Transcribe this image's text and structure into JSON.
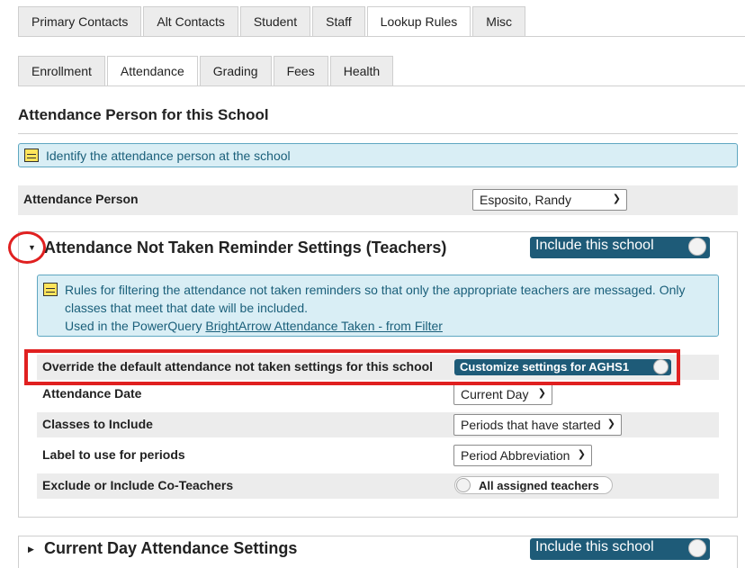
{
  "tabs_primary": [
    {
      "label": "Primary Contacts"
    },
    {
      "label": "Alt Contacts"
    },
    {
      "label": "Student"
    },
    {
      "label": "Staff"
    },
    {
      "label": "Lookup Rules"
    },
    {
      "label": "Misc"
    }
  ],
  "tabs_primary_active": "Lookup Rules",
  "tabs_secondary": [
    {
      "label": "Enrollment"
    },
    {
      "label": "Attendance"
    },
    {
      "label": "Grading"
    },
    {
      "label": "Fees"
    },
    {
      "label": "Health"
    }
  ],
  "tabs_secondary_active": "Attendance",
  "section": {
    "title": "Attendance Person for this School",
    "info": "Identify the attendance person at the school",
    "field_label": "Attendance Person",
    "field_value": "Esposito, Randy"
  },
  "reminder_panel": {
    "title": "Attendance Not Taken Reminder Settings (Teachers)",
    "toggle_label": "Include this school",
    "info_line1": "Rules for filtering the attendance not taken reminders so that only the appropriate teachers are messaged. Only",
    "info_line2": "classes that meet that date will be included.",
    "info_line3_prefix": "Used in the PowerQuery ",
    "info_link": "BrightArrow Attendance Taken - from Filter",
    "rows": {
      "override_label": "Override the default attendance not taken settings for this school",
      "override_toggle": "Customize settings for AGHS1",
      "date_label": "Attendance Date",
      "date_value": "Current Day",
      "classes_label": "Classes to Include",
      "classes_value": "Periods that have started",
      "period_label": "Label to use for periods",
      "period_value": "Period Abbreviation",
      "coteachers_label": "Exclude or Include Co-Teachers",
      "coteachers_toggle": "All assigned teachers"
    }
  },
  "current_day_panel": {
    "title": "Current Day Attendance Settings",
    "toggle_label": "Include this school"
  },
  "colors": {
    "accent": "#1e5b78",
    "info_bg": "#d9eef5",
    "info_border": "#5fa7c1",
    "highlight": "#e02020"
  }
}
